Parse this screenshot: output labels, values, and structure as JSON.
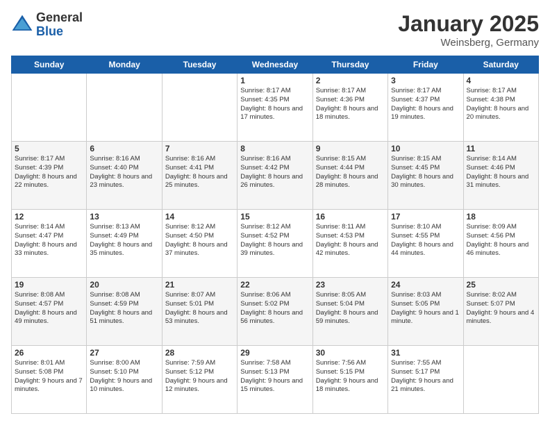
{
  "logo": {
    "general": "General",
    "blue": "Blue"
  },
  "title": "January 2025",
  "location": "Weinsberg, Germany",
  "days_of_week": [
    "Sunday",
    "Monday",
    "Tuesday",
    "Wednesday",
    "Thursday",
    "Friday",
    "Saturday"
  ],
  "weeks": [
    [
      {
        "day": "",
        "sunrise": "",
        "sunset": "",
        "daylight": ""
      },
      {
        "day": "",
        "sunrise": "",
        "sunset": "",
        "daylight": ""
      },
      {
        "day": "",
        "sunrise": "",
        "sunset": "",
        "daylight": ""
      },
      {
        "day": "1",
        "sunrise": "Sunrise: 8:17 AM",
        "sunset": "Sunset: 4:35 PM",
        "daylight": "Daylight: 8 hours and 17 minutes."
      },
      {
        "day": "2",
        "sunrise": "Sunrise: 8:17 AM",
        "sunset": "Sunset: 4:36 PM",
        "daylight": "Daylight: 8 hours and 18 minutes."
      },
      {
        "day": "3",
        "sunrise": "Sunrise: 8:17 AM",
        "sunset": "Sunset: 4:37 PM",
        "daylight": "Daylight: 8 hours and 19 minutes."
      },
      {
        "day": "4",
        "sunrise": "Sunrise: 8:17 AM",
        "sunset": "Sunset: 4:38 PM",
        "daylight": "Daylight: 8 hours and 20 minutes."
      }
    ],
    [
      {
        "day": "5",
        "sunrise": "Sunrise: 8:17 AM",
        "sunset": "Sunset: 4:39 PM",
        "daylight": "Daylight: 8 hours and 22 minutes."
      },
      {
        "day": "6",
        "sunrise": "Sunrise: 8:16 AM",
        "sunset": "Sunset: 4:40 PM",
        "daylight": "Daylight: 8 hours and 23 minutes."
      },
      {
        "day": "7",
        "sunrise": "Sunrise: 8:16 AM",
        "sunset": "Sunset: 4:41 PM",
        "daylight": "Daylight: 8 hours and 25 minutes."
      },
      {
        "day": "8",
        "sunrise": "Sunrise: 8:16 AM",
        "sunset": "Sunset: 4:42 PM",
        "daylight": "Daylight: 8 hours and 26 minutes."
      },
      {
        "day": "9",
        "sunrise": "Sunrise: 8:15 AM",
        "sunset": "Sunset: 4:44 PM",
        "daylight": "Daylight: 8 hours and 28 minutes."
      },
      {
        "day": "10",
        "sunrise": "Sunrise: 8:15 AM",
        "sunset": "Sunset: 4:45 PM",
        "daylight": "Daylight: 8 hours and 30 minutes."
      },
      {
        "day": "11",
        "sunrise": "Sunrise: 8:14 AM",
        "sunset": "Sunset: 4:46 PM",
        "daylight": "Daylight: 8 hours and 31 minutes."
      }
    ],
    [
      {
        "day": "12",
        "sunrise": "Sunrise: 8:14 AM",
        "sunset": "Sunset: 4:47 PM",
        "daylight": "Daylight: 8 hours and 33 minutes."
      },
      {
        "day": "13",
        "sunrise": "Sunrise: 8:13 AM",
        "sunset": "Sunset: 4:49 PM",
        "daylight": "Daylight: 8 hours and 35 minutes."
      },
      {
        "day": "14",
        "sunrise": "Sunrise: 8:12 AM",
        "sunset": "Sunset: 4:50 PM",
        "daylight": "Daylight: 8 hours and 37 minutes."
      },
      {
        "day": "15",
        "sunrise": "Sunrise: 8:12 AM",
        "sunset": "Sunset: 4:52 PM",
        "daylight": "Daylight: 8 hours and 39 minutes."
      },
      {
        "day": "16",
        "sunrise": "Sunrise: 8:11 AM",
        "sunset": "Sunset: 4:53 PM",
        "daylight": "Daylight: 8 hours and 42 minutes."
      },
      {
        "day": "17",
        "sunrise": "Sunrise: 8:10 AM",
        "sunset": "Sunset: 4:55 PM",
        "daylight": "Daylight: 8 hours and 44 minutes."
      },
      {
        "day": "18",
        "sunrise": "Sunrise: 8:09 AM",
        "sunset": "Sunset: 4:56 PM",
        "daylight": "Daylight: 8 hours and 46 minutes."
      }
    ],
    [
      {
        "day": "19",
        "sunrise": "Sunrise: 8:08 AM",
        "sunset": "Sunset: 4:57 PM",
        "daylight": "Daylight: 8 hours and 49 minutes."
      },
      {
        "day": "20",
        "sunrise": "Sunrise: 8:08 AM",
        "sunset": "Sunset: 4:59 PM",
        "daylight": "Daylight: 8 hours and 51 minutes."
      },
      {
        "day": "21",
        "sunrise": "Sunrise: 8:07 AM",
        "sunset": "Sunset: 5:01 PM",
        "daylight": "Daylight: 8 hours and 53 minutes."
      },
      {
        "day": "22",
        "sunrise": "Sunrise: 8:06 AM",
        "sunset": "Sunset: 5:02 PM",
        "daylight": "Daylight: 8 hours and 56 minutes."
      },
      {
        "day": "23",
        "sunrise": "Sunrise: 8:05 AM",
        "sunset": "Sunset: 5:04 PM",
        "daylight": "Daylight: 8 hours and 59 minutes."
      },
      {
        "day": "24",
        "sunrise": "Sunrise: 8:03 AM",
        "sunset": "Sunset: 5:05 PM",
        "daylight": "Daylight: 9 hours and 1 minute."
      },
      {
        "day": "25",
        "sunrise": "Sunrise: 8:02 AM",
        "sunset": "Sunset: 5:07 PM",
        "daylight": "Daylight: 9 hours and 4 minutes."
      }
    ],
    [
      {
        "day": "26",
        "sunrise": "Sunrise: 8:01 AM",
        "sunset": "Sunset: 5:08 PM",
        "daylight": "Daylight: 9 hours and 7 minutes."
      },
      {
        "day": "27",
        "sunrise": "Sunrise: 8:00 AM",
        "sunset": "Sunset: 5:10 PM",
        "daylight": "Daylight: 9 hours and 10 minutes."
      },
      {
        "day": "28",
        "sunrise": "Sunrise: 7:59 AM",
        "sunset": "Sunset: 5:12 PM",
        "daylight": "Daylight: 9 hours and 12 minutes."
      },
      {
        "day": "29",
        "sunrise": "Sunrise: 7:58 AM",
        "sunset": "Sunset: 5:13 PM",
        "daylight": "Daylight: 9 hours and 15 minutes."
      },
      {
        "day": "30",
        "sunrise": "Sunrise: 7:56 AM",
        "sunset": "Sunset: 5:15 PM",
        "daylight": "Daylight: 9 hours and 18 minutes."
      },
      {
        "day": "31",
        "sunrise": "Sunrise: 7:55 AM",
        "sunset": "Sunset: 5:17 PM",
        "daylight": "Daylight: 9 hours and 21 minutes."
      },
      {
        "day": "",
        "sunrise": "",
        "sunset": "",
        "daylight": ""
      }
    ]
  ]
}
